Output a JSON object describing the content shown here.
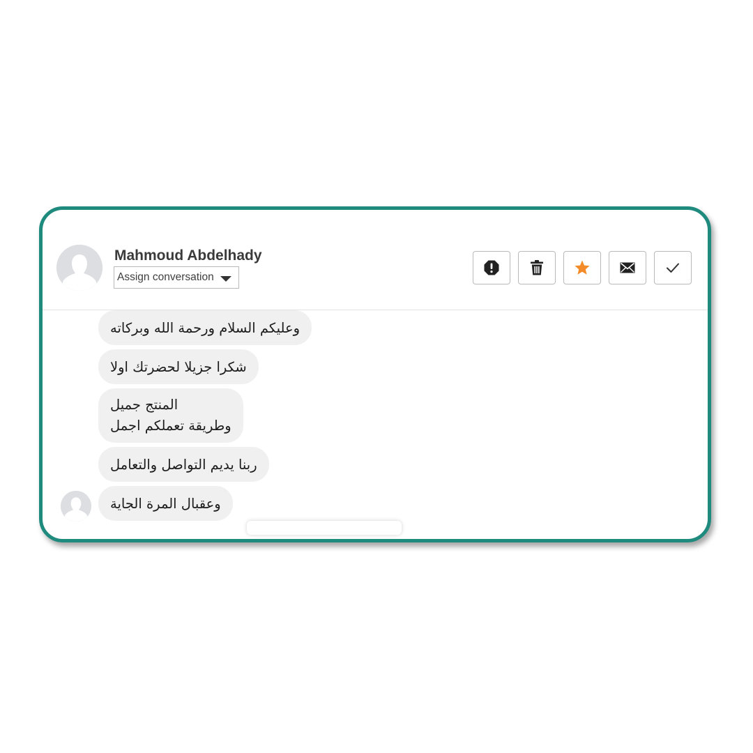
{
  "header": {
    "contact_name": "Mahmoud Abdelhady",
    "assign_label": "Assign conversation",
    "actions": [
      {
        "name": "spam",
        "icon": "exclamation-octagon-icon"
      },
      {
        "name": "delete",
        "icon": "trash-icon"
      },
      {
        "name": "star",
        "icon": "star-icon",
        "color": "#f38c28"
      },
      {
        "name": "mark-unread",
        "icon": "envelope-icon"
      },
      {
        "name": "mark-done",
        "icon": "check-icon"
      }
    ]
  },
  "messages": [
    {
      "text": "وعليكم السلام ورحمة الله وبركاته"
    },
    {
      "text": "شكرا جزيلا لحضرتك اولا"
    },
    {
      "lines": [
        "المنتج جميل",
        "وطريقة تعملكم اجمل"
      ]
    },
    {
      "text": "ربنا يديم التواصل والتعامل"
    },
    {
      "text": "وعقبال المرة الجاية"
    }
  ],
  "colors": {
    "frame_border": "#1f8a7e",
    "bubble_bg": "#f0f0f0",
    "star_accent": "#f38c28"
  }
}
